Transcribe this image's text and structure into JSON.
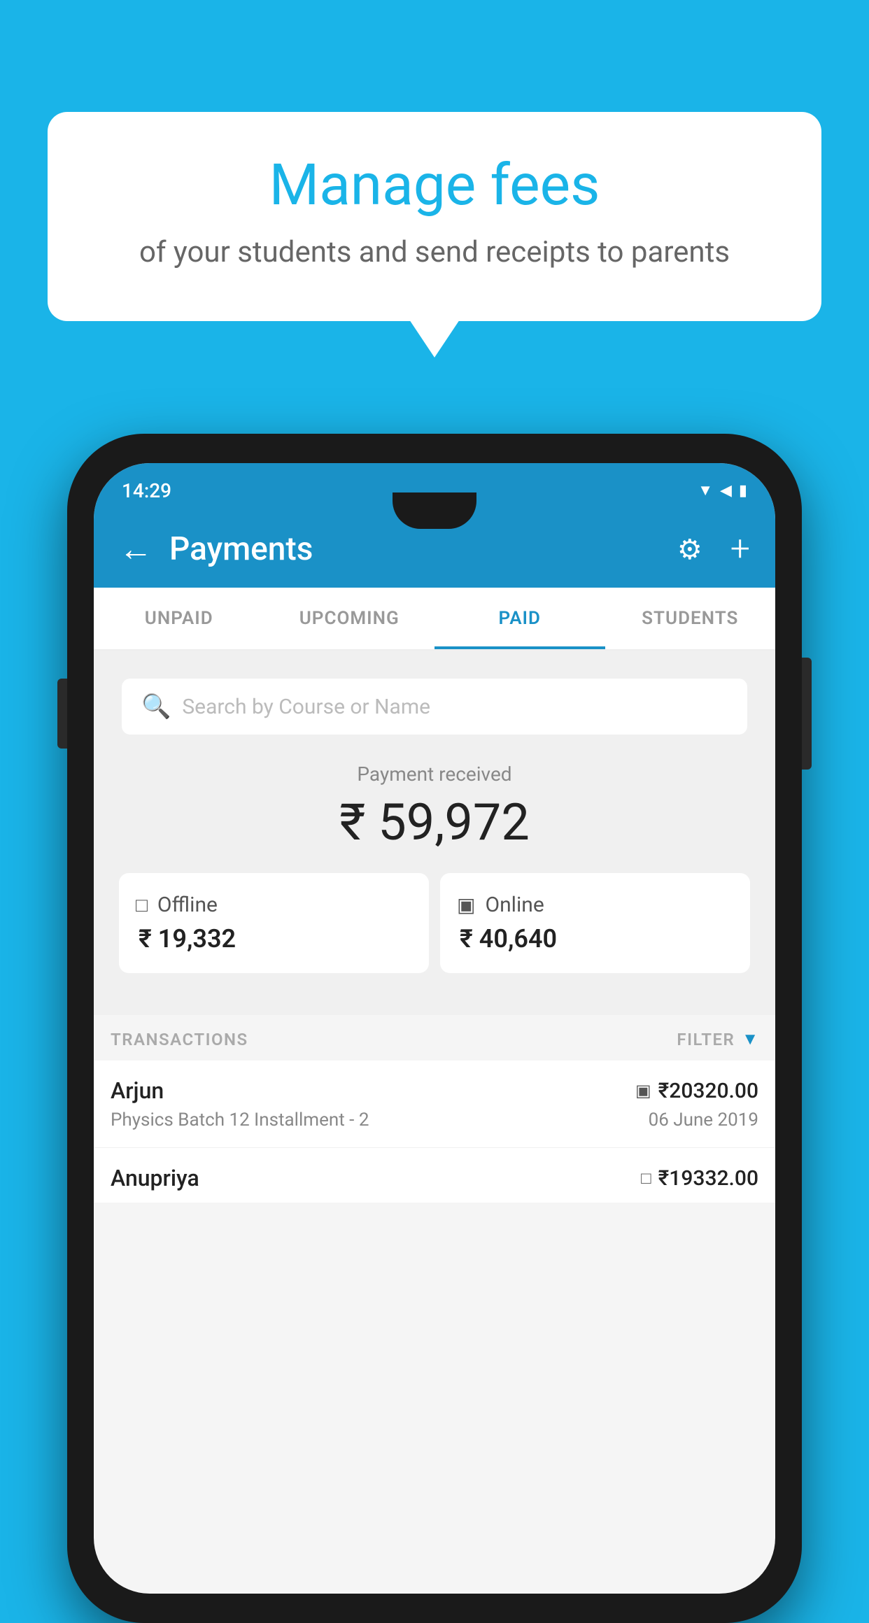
{
  "background_color": "#1ab4e8",
  "speech_bubble": {
    "title": "Manage fees",
    "subtitle": "of your students and send receipts to parents"
  },
  "status_bar": {
    "time": "14:29",
    "icons": "▼◀▮"
  },
  "header": {
    "title": "Payments",
    "back_icon": "←",
    "gear_icon": "⚙",
    "plus_icon": "+"
  },
  "tabs": [
    {
      "label": "UNPAID",
      "active": false
    },
    {
      "label": "UPCOMING",
      "active": false
    },
    {
      "label": "PAID",
      "active": true
    },
    {
      "label": "STUDENTS",
      "active": false
    }
  ],
  "search": {
    "placeholder": "Search by Course or Name"
  },
  "payment_summary": {
    "label": "Payment received",
    "amount": "₹ 59,972",
    "offline": {
      "type": "Offline",
      "amount": "₹ 19,332"
    },
    "online": {
      "type": "Online",
      "amount": "₹ 40,640"
    }
  },
  "transactions_section": {
    "label": "TRANSACTIONS",
    "filter_label": "FILTER"
  },
  "transactions": [
    {
      "name": "Arjun",
      "amount": "₹20320.00",
      "details": "Physics Batch 12 Installment - 2",
      "date": "06 June 2019",
      "payment_type": "card"
    },
    {
      "name": "Anupriya",
      "amount": "₹19332.00",
      "details": "",
      "date": "",
      "payment_type": "cash"
    }
  ]
}
